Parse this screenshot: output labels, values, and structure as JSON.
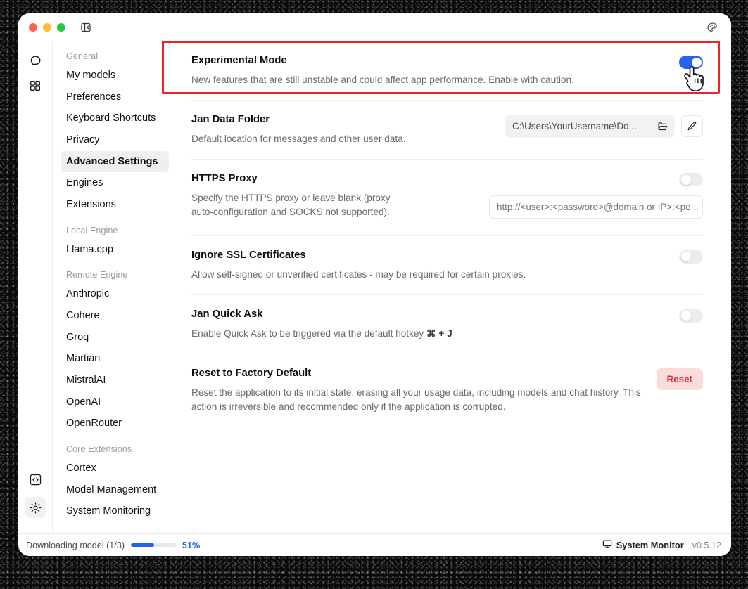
{
  "window": {
    "traffic_lights": [
      "close",
      "minimize",
      "maximize"
    ],
    "collapse_icon": "panel-collapse-icon",
    "palette_icon": "palette-icon"
  },
  "rail": {
    "items": [
      {
        "name": "chat-icon",
        "label": "Chat"
      },
      {
        "name": "grid-icon",
        "label": "Hub"
      }
    ],
    "bottom_items": [
      {
        "name": "code-icon",
        "label": "Local API Server"
      },
      {
        "name": "gear-icon",
        "label": "Settings",
        "active": true
      }
    ]
  },
  "nav": {
    "groups": [
      {
        "label": "General",
        "items": [
          {
            "label": "My models",
            "selected": false
          },
          {
            "label": "Preferences",
            "selected": false
          },
          {
            "label": "Keyboard Shortcuts",
            "selected": false
          },
          {
            "label": "Privacy",
            "selected": false
          },
          {
            "label": "Advanced Settings",
            "selected": true
          },
          {
            "label": "Engines",
            "selected": false
          },
          {
            "label": "Extensions",
            "selected": false
          }
        ]
      },
      {
        "label": "Local Engine",
        "items": [
          {
            "label": "Llama.cpp",
            "selected": false
          }
        ]
      },
      {
        "label": "Remote Engine",
        "items": [
          {
            "label": "Anthropic",
            "selected": false
          },
          {
            "label": "Cohere",
            "selected": false
          },
          {
            "label": "Groq",
            "selected": false
          },
          {
            "label": "Martian",
            "selected": false
          },
          {
            "label": "MistralAI",
            "selected": false
          },
          {
            "label": "OpenAI",
            "selected": false
          },
          {
            "label": "OpenRouter",
            "selected": false
          }
        ]
      },
      {
        "label": "Core Extensions",
        "items": [
          {
            "label": "Cortex",
            "selected": false
          },
          {
            "label": "Model Management",
            "selected": false
          },
          {
            "label": "System Monitoring",
            "selected": false
          }
        ]
      }
    ]
  },
  "settings": {
    "experimental_mode": {
      "title": "Experimental Mode",
      "desc": "New features that are still unstable and could affect app performance. Enable with caution.",
      "toggle_state": "on"
    },
    "data_folder": {
      "title": "Jan Data Folder",
      "desc": "Default location for messages and other user data.",
      "path_value": "C:\\Users\\YourUsername\\Do...",
      "folder_icon": "folder-open-icon",
      "edit_icon": "pencil-icon"
    },
    "https_proxy": {
      "title": "HTTPS Proxy",
      "desc": "Specify the HTTPS proxy or leave blank (proxy auto-configuration and SOCKS not supported).",
      "toggle_state": "off",
      "input_placeholder": "http://<user>:<password>@domain or IP>:<po..."
    },
    "ignore_ssl": {
      "title": "Ignore SSL Certificates",
      "desc": "Allow self-signed or unverified certificates - may be required for certain proxies.",
      "toggle_state": "off"
    },
    "quick_ask": {
      "title": "Jan Quick Ask",
      "desc_before": "Enable Quick Ask to be triggered via the default hotkey ",
      "hotkey": "⌘ + J",
      "toggle_state": "off"
    },
    "factory_reset": {
      "title": "Reset to Factory Default",
      "desc": "Reset the application to its initial state, erasing all your usage data, including models and chat history. This action is irreversible and recommended only if the application is corrupted.",
      "button_label": "Reset"
    }
  },
  "statusbar": {
    "download_label": "Downloading model (1/3)",
    "download_percent_label": "51%",
    "download_percent_value": 51,
    "system_monitor_label": "System Monitor",
    "monitor_icon": "display-icon",
    "version": "v0.5.12"
  },
  "colors": {
    "accent_blue": "#2563eb",
    "highlight_red": "#f01f28",
    "reset_red": "#e0343c",
    "reset_bg": "#fbdcdc"
  }
}
